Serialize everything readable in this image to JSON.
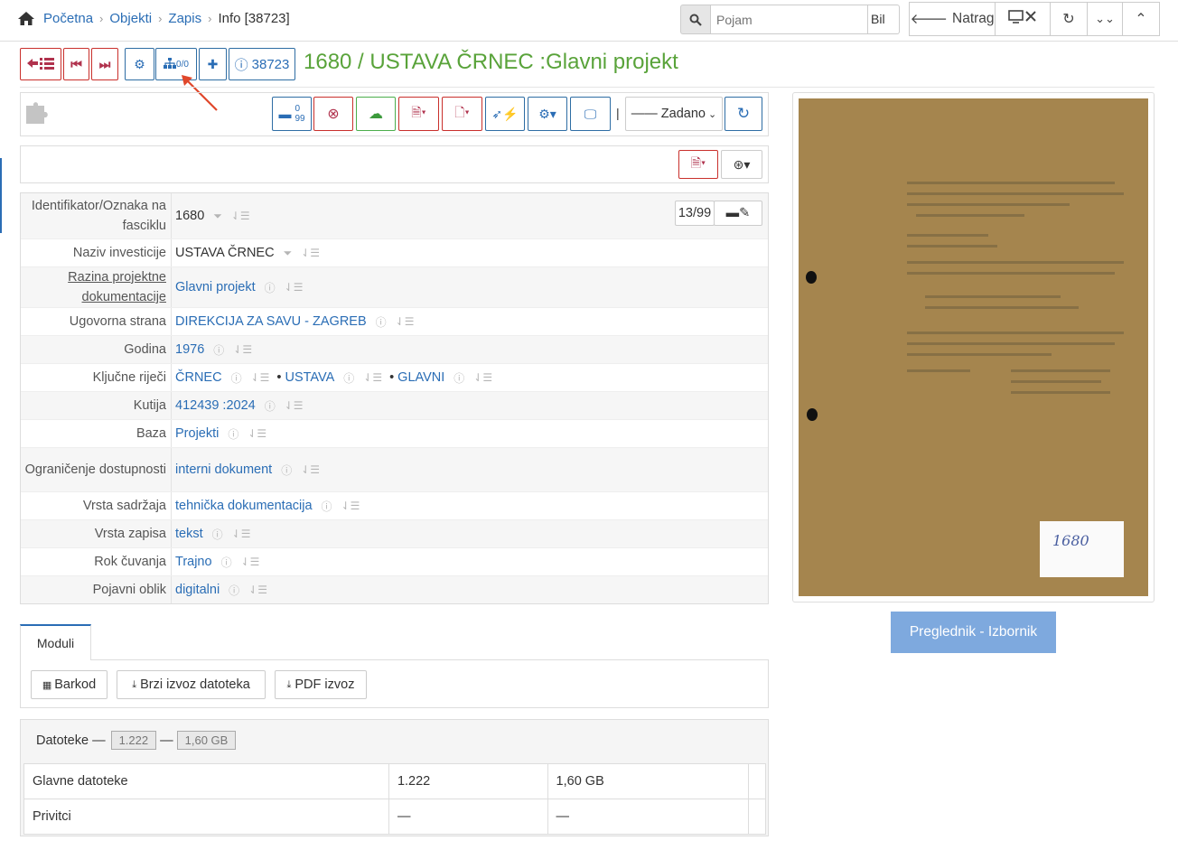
{
  "breadcrumb": {
    "home_icon": "home-icon",
    "items": [
      "Početna",
      "Objekti",
      "Zapis"
    ],
    "current": "Info [38723]"
  },
  "search": {
    "placeholder": "Pojam",
    "select_value": "Bil"
  },
  "nav": {
    "back_label": "Natrag"
  },
  "record": {
    "title": "1680 / USTAVA ČRNEC :Glavni projekt",
    "id_badge": "38723",
    "hierarchy_count": "0/0"
  },
  "toolbar": {
    "archive_counts": {
      "top": "0",
      "bottom": "99"
    },
    "select_value": "—— Zadano"
  },
  "fields": [
    {
      "label": "Identifikator/Oznaka na fasciklu",
      "value": "1680",
      "link": false
    },
    {
      "label": "Naziv investicije",
      "value": "USTAVA ČRNEC",
      "link": false
    },
    {
      "label": "Razina projektne dokumentacije",
      "value": "Glavni projekt",
      "link": true
    },
    {
      "label": "Ugovorna strana",
      "value": "DIREKCIJA ZA SAVU - ZAGREB",
      "link": true
    },
    {
      "label": "Godina",
      "value": "1976",
      "link": true
    },
    {
      "label": "Ključne riječi",
      "values": [
        "ČRNEC",
        "USTAVA",
        "GLAVNI"
      ],
      "link": true
    },
    {
      "label": "Kutija",
      "value": "412439 :2024",
      "link": true
    },
    {
      "label": "Baza",
      "value": "Projekti",
      "link": true
    },
    {
      "label": "Ograničenje dostupnosti",
      "value": "interni dokument",
      "link": true
    },
    {
      "label": "Vrsta sadržaja",
      "value": "tehnička dokumentacija",
      "link": true
    },
    {
      "label": "Vrsta zapisa",
      "value": "tekst",
      "link": true
    },
    {
      "label": "Rok čuvanja",
      "value": "Trajno",
      "link": true
    },
    {
      "label": "Pojavni oblik",
      "value": "digitalni",
      "link": true
    }
  ],
  "fascicle_badge": "13/99",
  "modules": {
    "tab": "Moduli",
    "buttons": [
      "Barkod",
      "Brzi izvoz datoteka",
      "PDF izvoz"
    ]
  },
  "files": {
    "label": "Datoteke —",
    "sep": "—",
    "count": "1.222",
    "size": "1,60 GB",
    "rows": [
      {
        "name": "Glavne datoteke",
        "count": "1.222",
        "size": "1,60 GB"
      },
      {
        "name": "Privitci",
        "count": "—",
        "size": "—"
      }
    ]
  },
  "preview": {
    "button": "Preglednik - Izbornik",
    "card_text": "1680"
  },
  "colors": {
    "title_green": "#59a33a",
    "link_blue": "#2a6db5",
    "accent_red": "#b0324d",
    "preview_button": "#7ea9de"
  }
}
